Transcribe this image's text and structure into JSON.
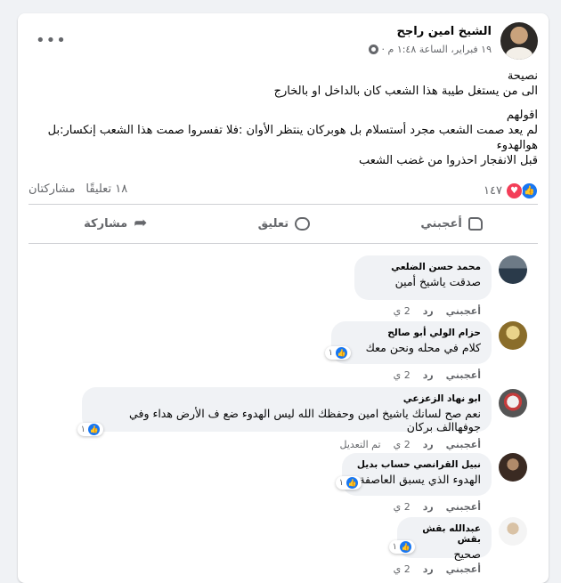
{
  "post": {
    "author": "الشيخ امين راجح",
    "meta": "١٩ فبراير، الساعة ١:٤٨ م ·",
    "more_icon": "more-dots-icon",
    "privacy_icon": "globe-icon",
    "text_lines": [
      "نصيحة",
      "الى من يستغل طيبة هذا الشعب  كان بالداخل او بالخارج",
      "اقولهم",
      "لم يعد صمت الشعب مجرد أستسلام بل هوبركان ينتظر الأوان :فلا تفسروا صمت هذا الشعب إنكسار:بل هوالهدوء",
      "قبل الانفجار احذروا من غضب الشعب"
    ],
    "reactions_count": "١٤٧",
    "comments_count": "١٨ تعليقًا",
    "shares_label": "مشاركتان",
    "accent": "#1877f2"
  },
  "actions": {
    "like": "أعجبني",
    "comment": "تعليق",
    "share": "مشاركة"
  },
  "comments": [
    {
      "name": "محمد حسن الضلعي",
      "text": "صدقت ياشيخ أمين",
      "like": "أعجبني",
      "reply": "رد",
      "time": "2 ي",
      "edited": "",
      "reacts": ""
    },
    {
      "name": "حزام الولي أبو صالح",
      "text": "كلام في محله ونحن معك",
      "like": "أعجبني",
      "reply": "رد",
      "time": "2 ي",
      "edited": "",
      "reacts": "١"
    },
    {
      "name": "ابو نهاد الزعزعي",
      "text": "نعم صح لسانك ياشيخ امين وحفظك الله ليس الهدوء ضع ف الأرض هداء وفي جوفهاالف بركان",
      "like": "أعجبني",
      "reply": "رد",
      "time": "2 ي",
      "edited": "تم التعديل",
      "reacts": "١"
    },
    {
      "name": "نبيل القرانصي حساب بديل",
      "text": "الهدوء الذي يسبق العاصفة",
      "like": "أعجبني",
      "reply": "رد",
      "time": "2 ي",
      "edited": "",
      "reacts": "١"
    },
    {
      "name": "عبدالله بقش بقش",
      "text": "صحيح",
      "like": "أعجبني",
      "reply": "رد",
      "time": "2 ي",
      "edited": "",
      "reacts": "١"
    }
  ]
}
